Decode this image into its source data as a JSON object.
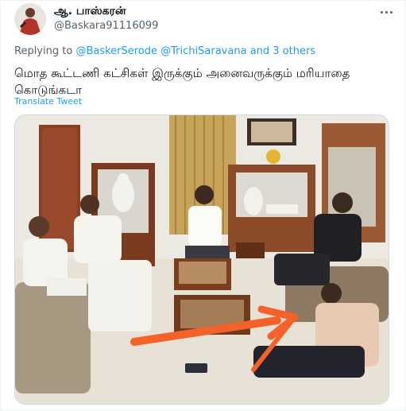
{
  "user": {
    "display_name": "ஆ. பாஸ்கரன்",
    "handle": "@Baskara91116099"
  },
  "reply": {
    "prefix": "Replying to",
    "mention_1": "@BaskerSerode",
    "mention_2": "@TrichiSaravana",
    "others": "and 3 others"
  },
  "tweet": {
    "text": "மொத கூட்டணி கட்சிகள் இருக்கும் அனைவருக்கும் மரியாதை கொடுங்கடா",
    "translate_label": "Translate Tweet"
  },
  "icons": {
    "more": "more-dots-icon"
  },
  "colors": {
    "link": "#1d9bf0",
    "secondary_text": "#536471",
    "border": "#cfd9de",
    "annotation_arrow": "#f3622b"
  }
}
